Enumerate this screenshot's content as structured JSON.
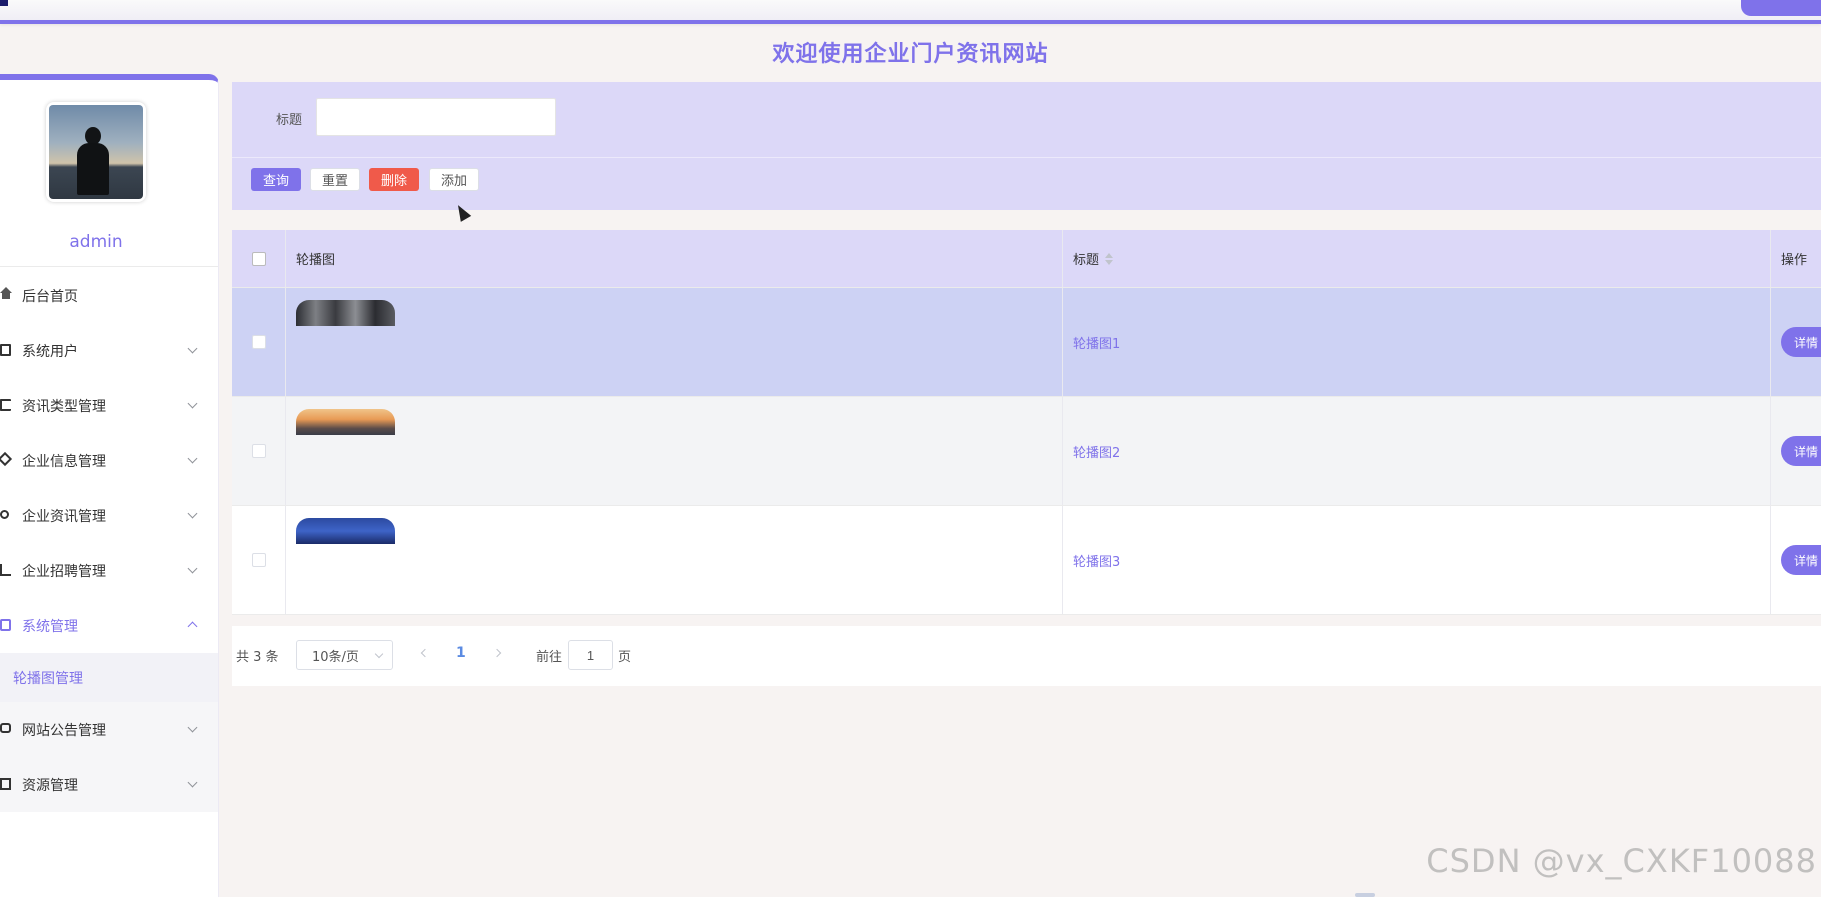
{
  "app": {
    "title": "欢迎使用企业门户资讯网站"
  },
  "sidebar": {
    "username": "admin",
    "items": [
      {
        "label": "后台首页",
        "icon": "home-icon"
      },
      {
        "label": "系统用户",
        "icon": "monitor-icon"
      },
      {
        "label": "资讯类型管理",
        "icon": "flag-icon"
      },
      {
        "label": "企业信息管理",
        "icon": "tag-icon"
      },
      {
        "label": "企业资讯管理",
        "icon": "sun-icon"
      },
      {
        "label": "企业招聘管理",
        "icon": "chart-icon"
      },
      {
        "label": "系统管理",
        "icon": "clipboard-icon"
      },
      {
        "label": "网站公告管理",
        "icon": "chat-icon"
      },
      {
        "label": "资源管理",
        "icon": "document-icon"
      }
    ],
    "submenu": {
      "label": "轮播图管理"
    }
  },
  "search": {
    "label": "标题",
    "value": "",
    "placeholder": ""
  },
  "toolbar": {
    "query": "查询",
    "reset": "重置",
    "delete": "删除",
    "add": "添加"
  },
  "table": {
    "headers": {
      "image": "轮播图",
      "title": "标题",
      "actions": "操作"
    },
    "rows": [
      {
        "title": "轮播图1",
        "action": "详情"
      },
      {
        "title": "轮播图2",
        "action": "详情"
      },
      {
        "title": "轮播图3",
        "action": "详情"
      }
    ]
  },
  "pagination": {
    "total": "共 3 条",
    "page_size": "10条/页",
    "current": "1",
    "goto_label": "前往",
    "goto_value": "1",
    "goto_suffix": "页"
  },
  "watermark": "CSDN @vx_CXKF10088",
  "colors": {
    "accent": "#7f72ea",
    "danger": "#f05a4a",
    "selected_row": "#cdd2f4"
  }
}
